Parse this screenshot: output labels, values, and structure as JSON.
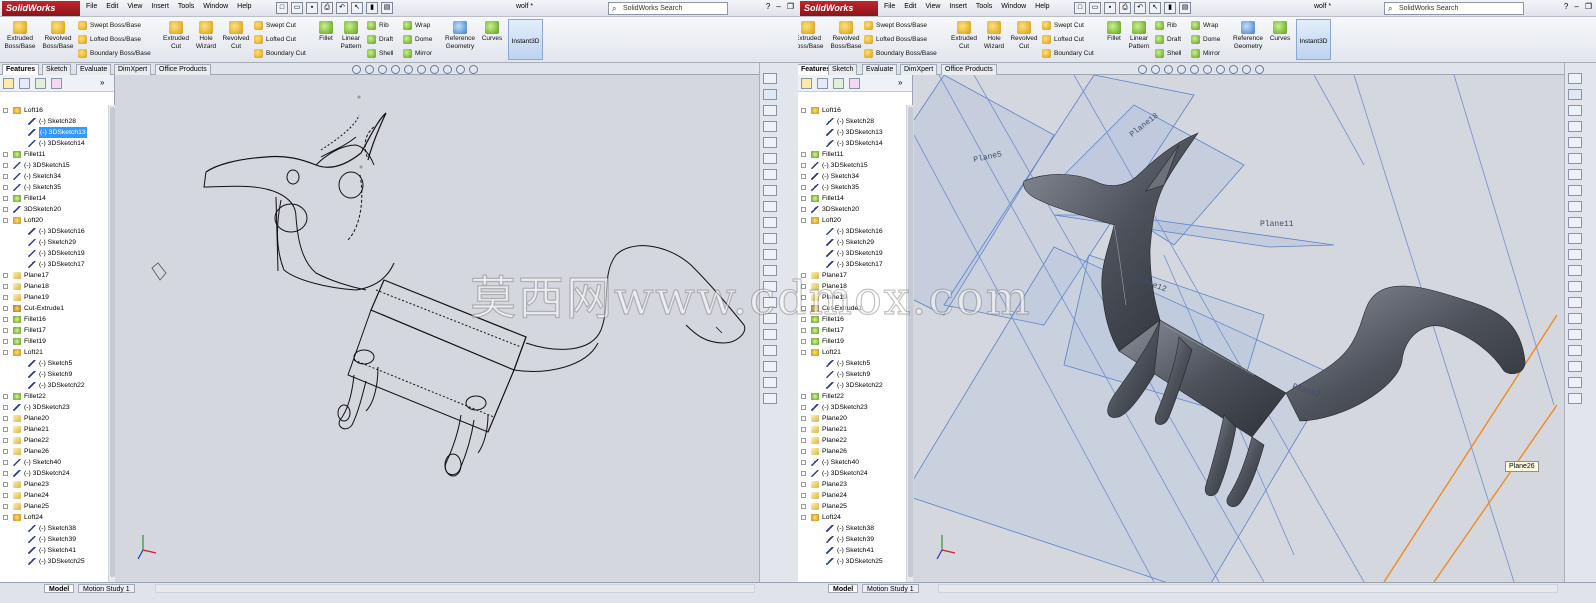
{
  "app": {
    "title": "SolidWorks",
    "document": "wolf *",
    "search_placeholder": "SolidWorks Search",
    "menus": [
      "File",
      "Edit",
      "View",
      "Insert",
      "Tools",
      "Window",
      "Help"
    ]
  },
  "ribbon": {
    "extruded_boss": "Extruded Boss/Base",
    "revolved_boss": "Revolved Boss/Base",
    "swept_boss": "Swept Boss/Base",
    "lofted_boss": "Lofted Boss/Base",
    "boundary_boss": "Boundary Boss/Base",
    "extruded_cut": "Extruded Cut",
    "hole_wizard": "Hole Wizard",
    "revolved_cut": "Revolved Cut",
    "swept_cut": "Swept Cut",
    "lofted_cut": "Lofted Cut",
    "boundary_cut": "Boundary Cut",
    "fillet": "Fillet",
    "linear_pattern": "Linear Pattern",
    "rib": "Rib",
    "draft": "Draft",
    "shell": "Shell",
    "wrap": "Wrap",
    "dome": "Dome",
    "mirror": "Mirror",
    "reference_geometry": "Reference Geometry",
    "curves": "Curves",
    "instant3d": "Instant3D"
  },
  "tabs": [
    "Features",
    "Sketch",
    "Evaluate",
    "DimXpert",
    "Office Products"
  ],
  "tree_items": [
    {
      "label": "Loft16",
      "level": 0,
      "icon": "yellow"
    },
    {
      "label": "(-) Sketch28",
      "level": 1,
      "icon": "sketch"
    },
    {
      "label": "(-) 3DSketch13",
      "level": 1,
      "icon": "sketch"
    },
    {
      "label": "(-) 3DSketch14",
      "level": 1,
      "icon": "sketch"
    },
    {
      "label": "Fillet11",
      "level": 0,
      "icon": "green"
    },
    {
      "label": "(-) 3DSketch15",
      "level": 0,
      "icon": "sketch"
    },
    {
      "label": "(-) Sketch34",
      "level": 0,
      "icon": "sketch"
    },
    {
      "label": "(-) Sketch35",
      "level": 0,
      "icon": "sketch"
    },
    {
      "label": "Fillet14",
      "level": 0,
      "icon": "green"
    },
    {
      "label": "3DSketch20",
      "level": 0,
      "icon": "sketch"
    },
    {
      "label": "Loft20",
      "level": 0,
      "icon": "yellow"
    },
    {
      "label": "(-) 3DSketch16",
      "level": 1,
      "icon": "sketch"
    },
    {
      "label": "(-) Sketch29",
      "level": 1,
      "icon": "sketch"
    },
    {
      "label": "(-) 3DSketch19",
      "level": 1,
      "icon": "sketch"
    },
    {
      "label": "(-) 3DSketch17",
      "level": 1,
      "icon": "sketch"
    },
    {
      "label": "Plane17",
      "level": 0,
      "icon": "plane"
    },
    {
      "label": "Plane18",
      "level": 0,
      "icon": "plane"
    },
    {
      "label": "Plane19",
      "level": 0,
      "icon": "plane"
    },
    {
      "label": "Cut-Extrude1",
      "level": 0,
      "icon": "cut"
    },
    {
      "label": "Fillet16",
      "level": 0,
      "icon": "green"
    },
    {
      "label": "Fillet17",
      "level": 0,
      "icon": "green"
    },
    {
      "label": "Fillet19",
      "level": 0,
      "icon": "green"
    },
    {
      "label": "Loft21",
      "level": 0,
      "icon": "yellow"
    },
    {
      "label": "(-) Sketch5",
      "level": 1,
      "icon": "sketch"
    },
    {
      "label": "(-) Sketch9",
      "level": 1,
      "icon": "sketch"
    },
    {
      "label": "(-) 3DSketch22",
      "level": 1,
      "icon": "sketch"
    },
    {
      "label": "Fillet22",
      "level": 0,
      "icon": "green"
    },
    {
      "label": "(-) 3DSketch23",
      "level": 0,
      "icon": "sketch"
    },
    {
      "label": "Plane20",
      "level": 0,
      "icon": "plane"
    },
    {
      "label": "Plane21",
      "level": 0,
      "icon": "plane"
    },
    {
      "label": "Plane22",
      "level": 0,
      "icon": "plane"
    },
    {
      "label": "Plane26",
      "level": 0,
      "icon": "plane"
    },
    {
      "label": "(-) Sketch40",
      "level": 0,
      "icon": "sketch"
    },
    {
      "label": "(-) 3DSketch24",
      "level": 0,
      "icon": "sketch"
    },
    {
      "label": "Plane23",
      "level": 0,
      "icon": "plane"
    },
    {
      "label": "Plane24",
      "level": 0,
      "icon": "plane"
    },
    {
      "label": "Plane25",
      "level": 0,
      "icon": "plane"
    },
    {
      "label": "Loft24",
      "level": 0,
      "icon": "yellow"
    },
    {
      "label": "(-) Sketch38",
      "level": 1,
      "icon": "sketch"
    },
    {
      "label": "(-) Sketch39",
      "level": 1,
      "icon": "sketch"
    },
    {
      "label": "(-) Sketch41",
      "level": 1,
      "icon": "sketch"
    },
    {
      "label": "(-) 3DSketch25",
      "level": 1,
      "icon": "sketch"
    }
  ],
  "selected_item_left": "(-) 3DSketch13",
  "bottom_tabs": [
    "Model",
    "Motion Study 1"
  ],
  "watermark": "莫西网www.cdmox.com",
  "planes_right": [
    "Plane18",
    "Plane11",
    "Plane12",
    "Plane2",
    "Plane5"
  ],
  "tooltip": "Plane26",
  "colors": {
    "accent": "#3399ff",
    "brand": "#c0272d"
  }
}
